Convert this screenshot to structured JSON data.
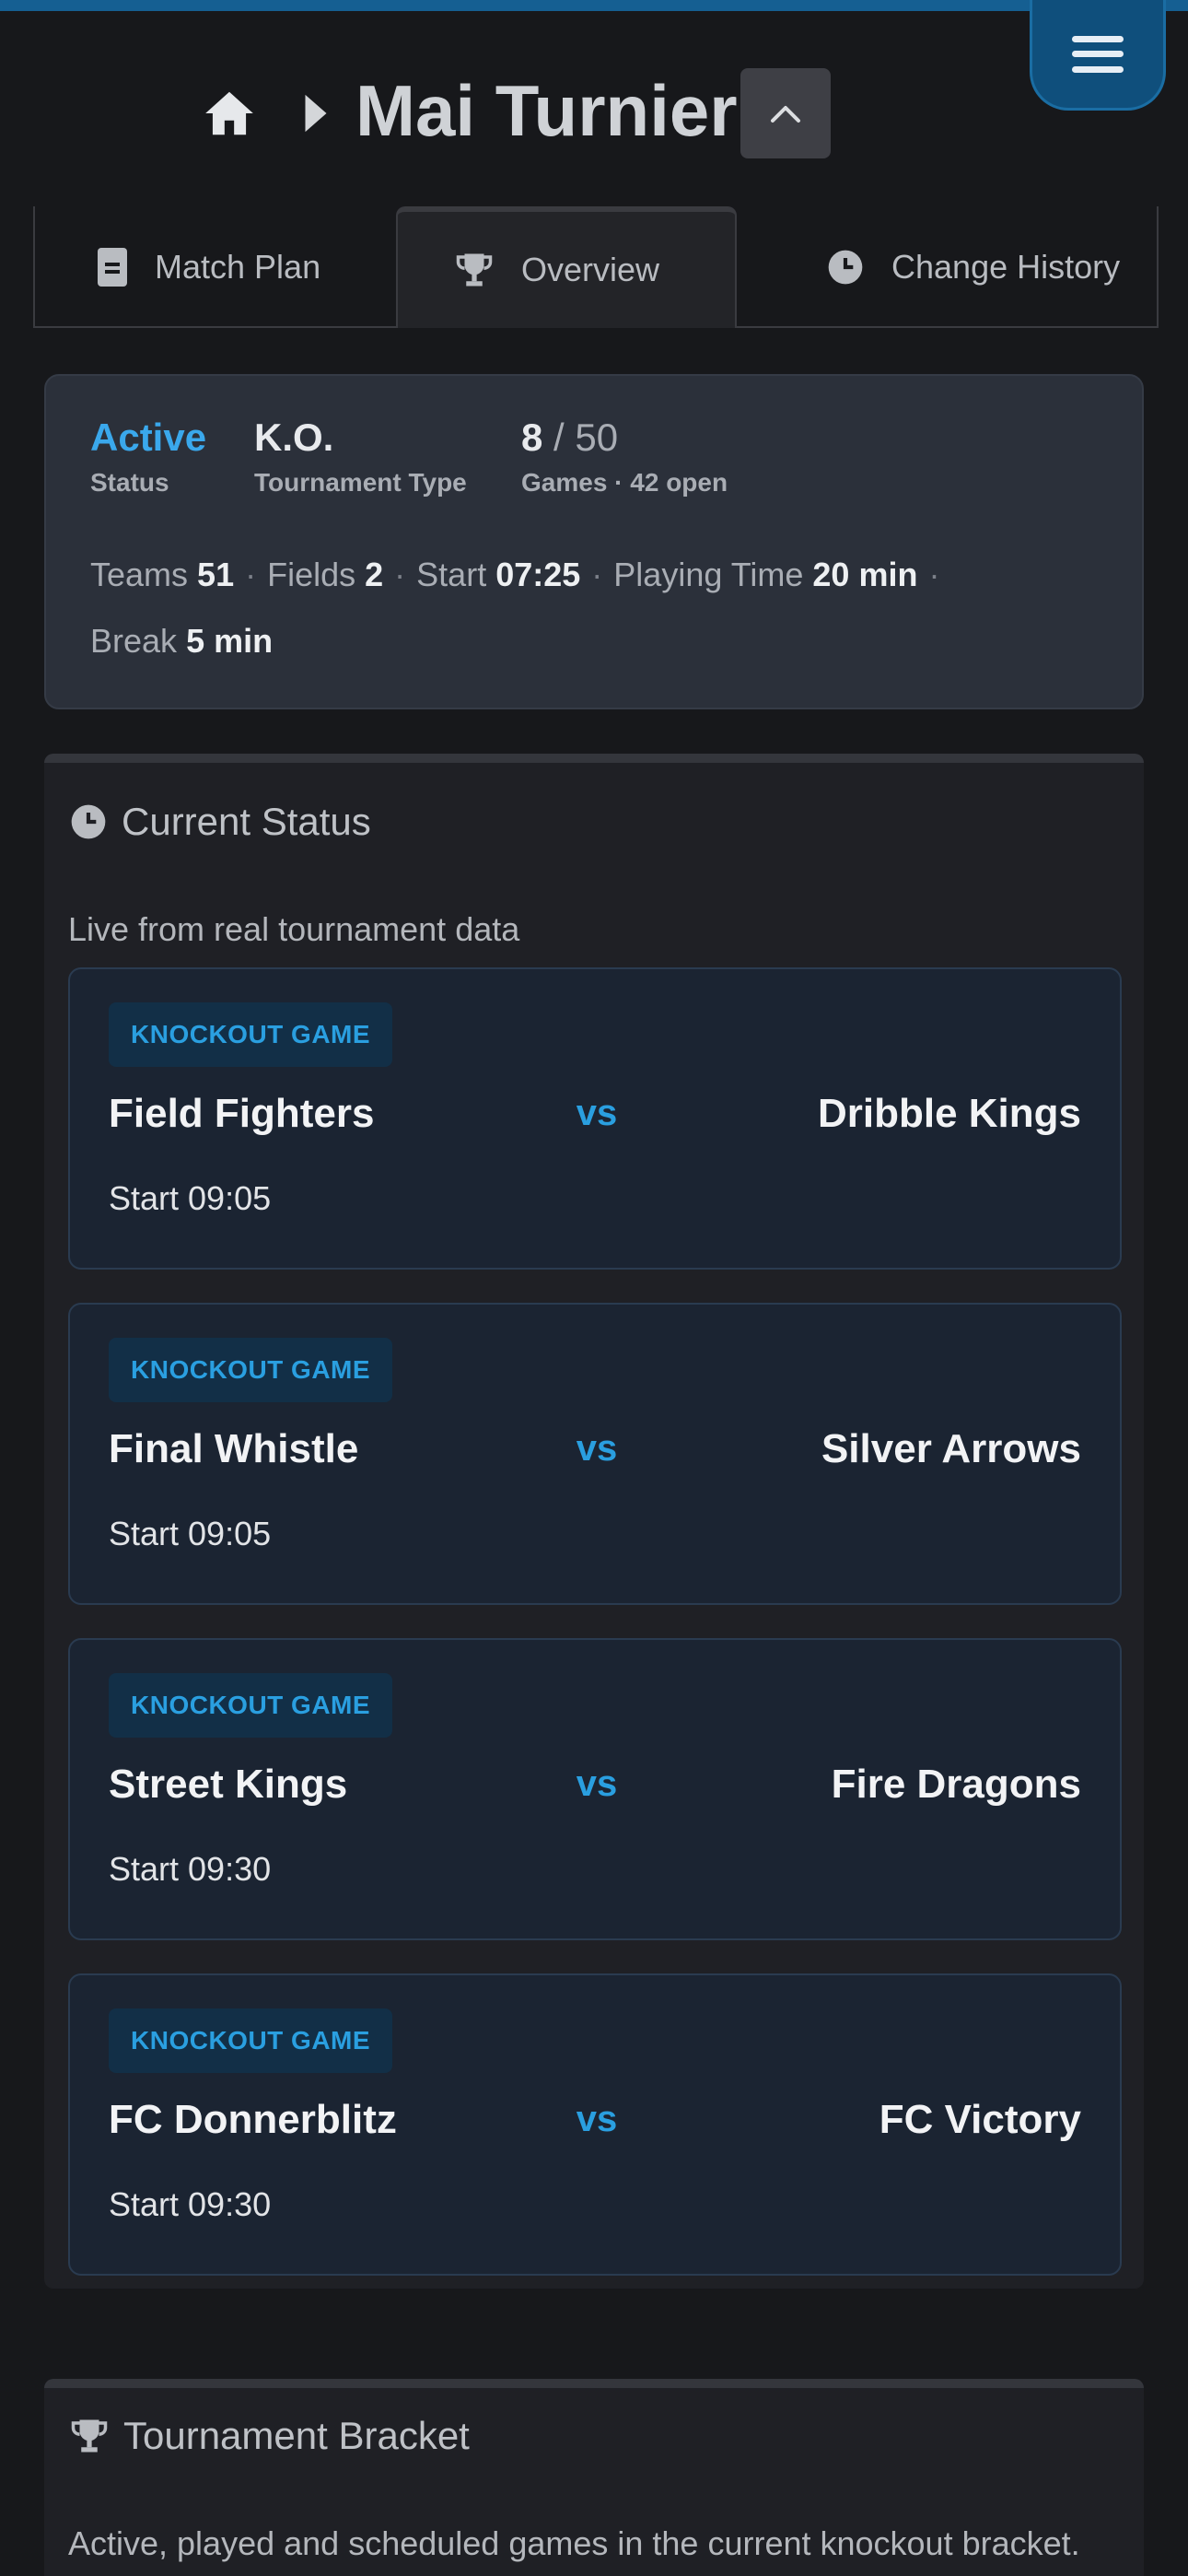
{
  "header": {
    "title": "Mai Turnier"
  },
  "tabs": [
    {
      "label": "Match Plan",
      "icon": "document-icon",
      "active": false
    },
    {
      "label": "Overview",
      "icon": "trophy-icon",
      "active": true
    },
    {
      "label": "Change History",
      "icon": "clock-icon",
      "active": false
    }
  ],
  "summary": {
    "status_value": "Active",
    "status_label": "Status",
    "type_value": "K.O.",
    "type_label": "Tournament Type",
    "games_played": "8",
    "games_total": "/ 50",
    "games_label": "Games · 42 open",
    "teams_label": "Teams",
    "teams_value": "51",
    "fields_label": "Fields",
    "fields_value": "2",
    "start_label": "Start",
    "start_value": "07:25",
    "playing_label": "Playing Time",
    "playing_value": "20 min",
    "break_label": "Break",
    "break_value": "5 min"
  },
  "current_status": {
    "title": "Current Status",
    "subtitle": "Live from real tournament data",
    "matches": [
      {
        "badge": "KNOCKOUT GAME",
        "team_a": "Field Fighters",
        "vs": "vs",
        "team_b": "Dribble Kings",
        "start": "Start 09:05"
      },
      {
        "badge": "KNOCKOUT GAME",
        "team_a": "Final Whistle",
        "vs": "vs",
        "team_b": "Silver Arrows",
        "start": "Start 09:05"
      },
      {
        "badge": "KNOCKOUT GAME",
        "team_a": "Street Kings",
        "vs": "vs",
        "team_b": "Fire Dragons",
        "start": "Start 09:30"
      },
      {
        "badge": "KNOCKOUT GAME",
        "team_a": "FC Donnerblitz",
        "vs": "vs",
        "team_b": "FC Victory",
        "start": "Start 09:30"
      }
    ]
  },
  "bracket": {
    "title": "Tournament Bracket",
    "subtitle": "Active, played and scheduled games in the current knockout bracket."
  },
  "colors": {
    "accent": "#2a9fe0",
    "status_active": "#3aa8ec",
    "background": "#17181b"
  }
}
